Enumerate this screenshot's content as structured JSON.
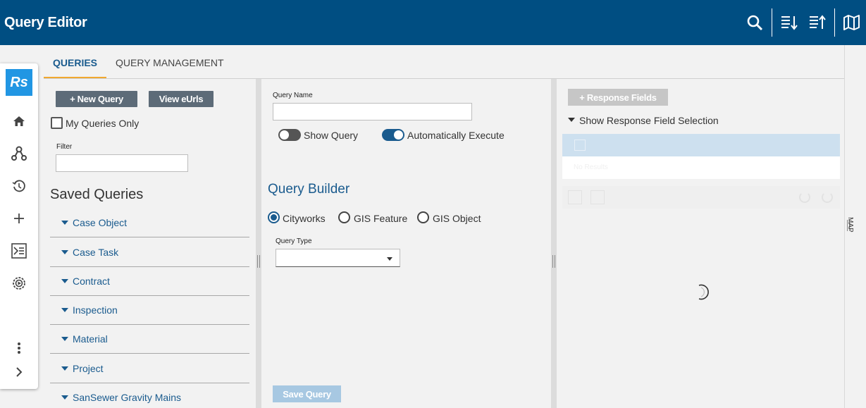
{
  "header": {
    "title": "Query Editor"
  },
  "rail": {
    "logo_text": "Rs"
  },
  "tabs": [
    {
      "label": "QUERIES"
    },
    {
      "label": "QUERY MANAGEMENT"
    }
  ],
  "left": {
    "new_query_label": "+ New Query",
    "view_eurls_label": "View eUrls",
    "my_queries_label": "My Queries Only",
    "filter_label": "Filter",
    "filter_value": "",
    "saved_title": "Saved Queries",
    "saved_items": [
      {
        "label": "Case Object"
      },
      {
        "label": "Case Task"
      },
      {
        "label": "Contract"
      },
      {
        "label": "Inspection"
      },
      {
        "label": "Material"
      },
      {
        "label": "Project"
      },
      {
        "label": "SanSewer Gravity Mains"
      }
    ]
  },
  "middle": {
    "query_name_label": "Query Name",
    "query_name_value": "",
    "show_query_label": "Show Query",
    "auto_execute_label": "Automatically Execute",
    "builder_title": "Query Builder",
    "radio_options": [
      {
        "label": "Cityworks"
      },
      {
        "label": "GIS Feature"
      },
      {
        "label": "GIS Object"
      }
    ],
    "query_type_label": "Query Type",
    "query_type_value": "",
    "save_label": "Save Query"
  },
  "right": {
    "response_fields_label": "+ Response Fields",
    "show_selection_label": "Show Response Field Selection",
    "no_results_label": "No Results"
  },
  "map": {
    "label": "MAP"
  },
  "colors": {
    "header_bg": "#004e82",
    "accent": "#1a5b8e",
    "tab_underline": "#f0a830",
    "toggle_on": "#1a5b8e"
  }
}
